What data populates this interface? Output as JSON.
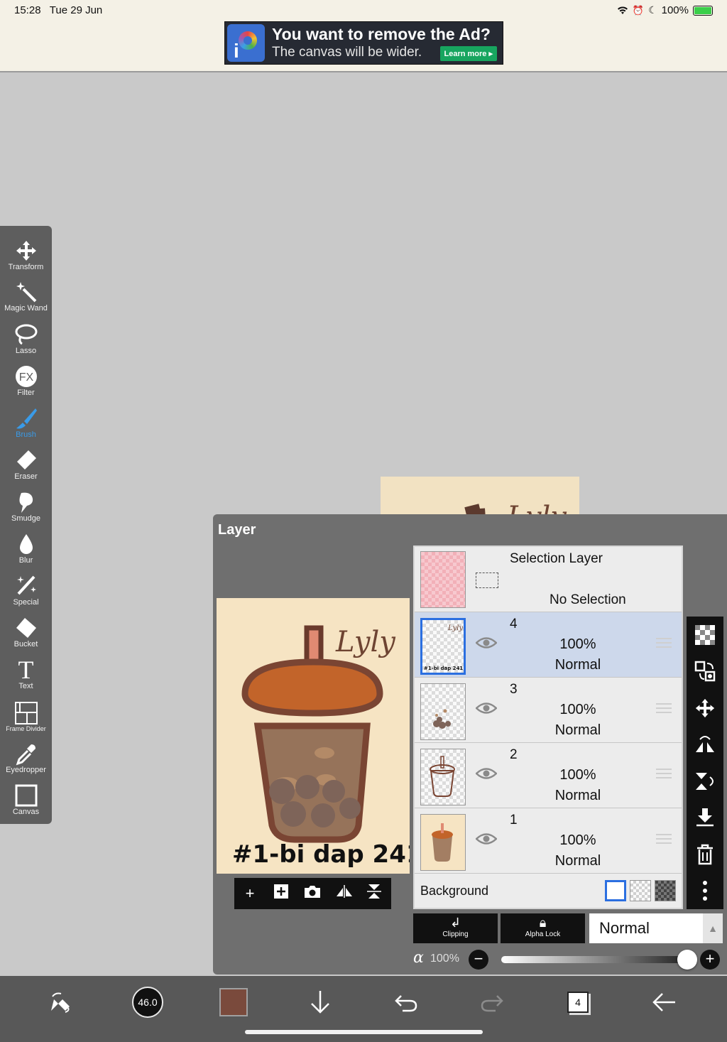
{
  "status": {
    "time": "15:28",
    "date": "Tue 29 Jun",
    "battery": "100%",
    "battery_level": 1.0
  },
  "ad": {
    "title": "You want to remove the Ad?",
    "subtitle": "The canvas will be wider.",
    "button": "Learn more ▸"
  },
  "toolbox": {
    "items": [
      {
        "label": "Transform",
        "icon": "move-arrows-icon"
      },
      {
        "label": "Magic Wand",
        "icon": "magic-wand-icon"
      },
      {
        "label": "Lasso",
        "icon": "lasso-icon"
      },
      {
        "label": "Filter",
        "icon": "fx-icon"
      },
      {
        "label": "Brush",
        "icon": "brush-icon",
        "active": true
      },
      {
        "label": "Eraser",
        "icon": "eraser-icon"
      },
      {
        "label": "Smudge",
        "icon": "smudge-icon"
      },
      {
        "label": "Blur",
        "icon": "drop-icon"
      },
      {
        "label": "Special",
        "icon": "sparkle-brush-icon"
      },
      {
        "label": "Bucket",
        "icon": "bucket-icon"
      },
      {
        "label": "Text",
        "icon": "text-icon"
      },
      {
        "label": "Frame Divider",
        "icon": "frame-divider-icon"
      },
      {
        "label": "Eyedropper",
        "icon": "eyedropper-icon"
      },
      {
        "label": "Canvas",
        "icon": "canvas-icon"
      }
    ]
  },
  "layer_panel": {
    "title": "Layer",
    "artwork": {
      "signature": "Lyly",
      "caption": "#1-bi dap 241"
    },
    "selection_layer": {
      "name": "Selection Layer",
      "status": "No Selection"
    },
    "layers": [
      {
        "number": "4",
        "opacity": "100%",
        "mode": "Normal",
        "selected": true
      },
      {
        "number": "3",
        "opacity": "100%",
        "mode": "Normal",
        "selected": false
      },
      {
        "number": "2",
        "opacity": "100%",
        "mode": "Normal",
        "selected": false
      },
      {
        "number": "1",
        "opacity": "100%",
        "mode": "Normal",
        "selected": false
      }
    ],
    "background_label": "Background",
    "clipping_label": "Clipping",
    "alpha_lock_label": "Alpha Lock",
    "blend_mode": "Normal",
    "alpha_symbol": "α",
    "alpha_value": "100%",
    "alpha_level": 1.0
  },
  "bottom_bar": {
    "brush_size": "46.0",
    "layer_count": "4",
    "brush_color": "#7a4a3c"
  },
  "colors": {
    "accent": "#3a9be8",
    "selected_layer": "#cdd8eb",
    "panel": "#6f6f6f"
  }
}
